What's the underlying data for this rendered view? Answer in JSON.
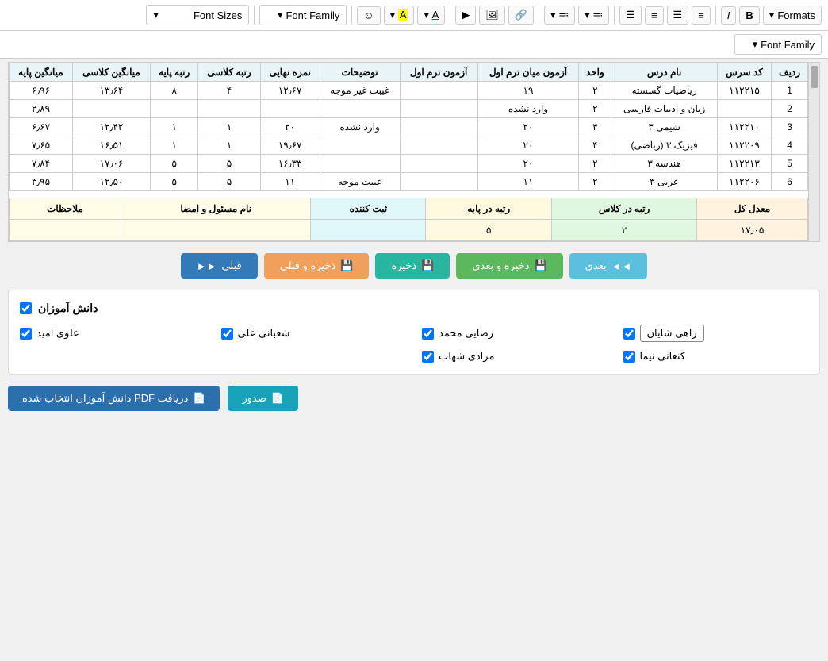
{
  "toolbar": {
    "formats_label": "Formats",
    "formats_arrow": "▾",
    "bold": "B",
    "italic": "I",
    "align_left": "≡",
    "align_center": "≡",
    "align_right": "≡",
    "justify": "≡",
    "list_ul": "☰",
    "list_ol": "☰",
    "link_icon": "🔗",
    "image_icon": "🖼",
    "video_icon": "▶",
    "font_color": "A",
    "font_bg": "A",
    "emoji": "☺",
    "font_family_label": "Font Family",
    "font_family_arrow": "▾",
    "font_sizes_label": "Font Sizes",
    "font_sizes_arrow": "▾"
  },
  "table_headers": [
    "ردیف",
    "کد سرس",
    "نام درس",
    "واحد",
    "آزمون میان ترم اول",
    "آزمون ترم اول",
    "توضیحات",
    "نمره نهایی",
    "رتبه کلاسی",
    "رتبه پایه",
    "میانگین کلاسی",
    "میانگین پایه"
  ],
  "table_rows": [
    {
      "radif": "1",
      "kod": "۱۱۲۲۱۵",
      "dars": "ریاضیات گسسته",
      "vahed": "۲",
      "mian1": "۱۹",
      "azmon1": "",
      "tozih": "غیبت غیر موجه",
      "nomre": "۱۲٫۶۷",
      "rotbe_k": "۴",
      "rotbe_p": "۸",
      "mian_k": "۱۳٫۶۴",
      "mian_p": "۶٫۹۶"
    },
    {
      "radif": "2",
      "kod": "",
      "dars": "زبان و ادبیات فارسی",
      "vahed": "۲",
      "mian1": "وارد نشده",
      "azmon1": "",
      "tozih": "",
      "nomre": "",
      "rotbe_k": "",
      "rotbe_p": "",
      "mian_k": "",
      "mian_p": "۲٫۸۹"
    },
    {
      "radif": "3",
      "kod": "۱۱۲۲۱۰",
      "dars": "شیمی ۳",
      "vahed": "۴",
      "mian1": "۲۰",
      "azmon1": "",
      "tozih": "وارد نشده",
      "nomre": "۲۰",
      "rotbe_k": "۱",
      "rotbe_p": "۱",
      "mian_k": "۱۲٫۴۲",
      "mian_p": "۶٫۶۷"
    },
    {
      "radif": "4",
      "kod": "۱۱۲۲۰۹",
      "dars": "فیزیک ۳ (ریاضی)",
      "vahed": "۴",
      "mian1": "۲۰",
      "azmon1": "",
      "tozih": "",
      "nomre": "۱۹٫۶۷",
      "rotbe_k": "۱",
      "rotbe_p": "۱",
      "mian_k": "۱۶٫۵۱",
      "mian_p": "۷٫۶۵"
    },
    {
      "radif": "5",
      "kod": "۱۱۲۲۱۳",
      "dars": "هندسه ۳",
      "vahed": "۲",
      "mian1": "۲۰",
      "azmon1": "",
      "tozih": "",
      "nomre": "۱۶٫۳۳",
      "rotbe_k": "۵",
      "rotbe_p": "۵",
      "mian_k": "۱۷٫۰۶",
      "mian_p": "۷٫۸۴"
    },
    {
      "radif": "6",
      "kod": "۱۱۲۲۰۶",
      "dars": "عربی ۳",
      "vahed": "۲",
      "mian1": "۱۱",
      "azmon1": "",
      "tozih": "غیبت موجه",
      "nomre": "۱۱",
      "rotbe_k": "۵",
      "rotbe_p": "۵",
      "mian_k": "۱۲٫۵۰",
      "mian_p": "۳٫۹۵"
    }
  ],
  "summary": {
    "headers": {
      "moalazat": "ملاحظات",
      "masool": "نام مسئول و امضا",
      "sabt": "ثبت کننده",
      "rotbe_paye": "رتبه در پایه",
      "rotbe_class": "رتبه در کلاس",
      "moaddal": "معدل کل"
    },
    "values": {
      "moalazat": "",
      "masool": "",
      "sabt": "",
      "rotbe_paye": "۵",
      "rotbe_class": "۲",
      "moaddal": "۱۷٫۰۵"
    }
  },
  "nav_buttons": {
    "badi": "بعدی",
    "zakhire_badi": "ذخیره و بعدی",
    "zakhire": "ذخیره",
    "zakhire_qabli": "ذخیره و قبلی",
    "qabli": "قبلی"
  },
  "students_section": {
    "header": "دانش آموزان",
    "students": [
      {
        "name": "راهی شایان",
        "highlighted": true
      },
      {
        "name": "رضایی محمد",
        "highlighted": false
      },
      {
        "name": "شعبانی علی",
        "highlighted": false
      },
      {
        "name": "علوی امید",
        "highlighted": false
      },
      {
        "name": "کنعانی نیما",
        "highlighted": false
      },
      {
        "name": "مرادی شهاب",
        "highlighted": false
      }
    ]
  },
  "pdf_buttons": {
    "sadr": "صدور",
    "daryaft": "دریافت PDF دانش آموزان انتخاب شده"
  },
  "icons": {
    "save": "💾",
    "arrow_right": "◄◄",
    "arrow_left": "►►",
    "pdf": "📄",
    "dropdown_arrow": "▾",
    "checkbox_checked": "✓"
  }
}
